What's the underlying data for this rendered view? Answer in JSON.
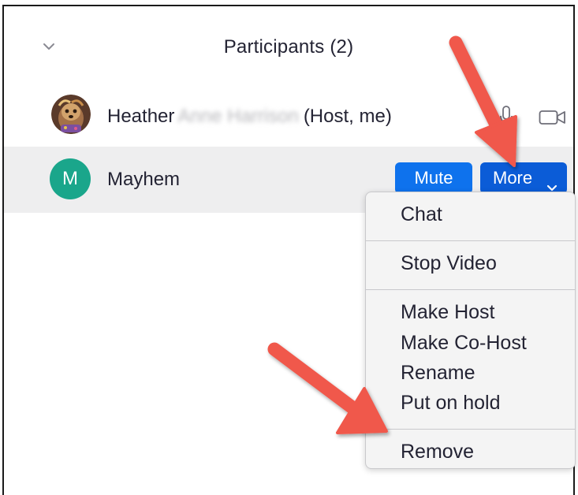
{
  "panel": {
    "title": "Participants (2)"
  },
  "participants": [
    {
      "first_name": "Heather",
      "redacted_name": "Anne Harrison",
      "role_suffix": "(Host, me)",
      "avatar": "photo-avatar"
    },
    {
      "name": "Mayhem",
      "initial": "M",
      "avatar_color": "#1aa68b"
    }
  ],
  "actions": {
    "mute_label": "Mute",
    "more_label": "More"
  },
  "menu": {
    "items": [
      "Chat",
      "Stop Video",
      "Make Host",
      "Make Co-Host",
      "Rename",
      "Put on hold",
      "Remove"
    ]
  },
  "colors": {
    "mute_button": "#0e72ed",
    "more_button": "#0b5cd7",
    "selected_row": "#eeeeef",
    "annotation_arrow": "#f0584c"
  },
  "icons": {
    "collapse": "chevron-down-icon",
    "mic": "microphone-icon",
    "video": "video-camera-icon",
    "more_chevron": "chevron-down-icon"
  }
}
